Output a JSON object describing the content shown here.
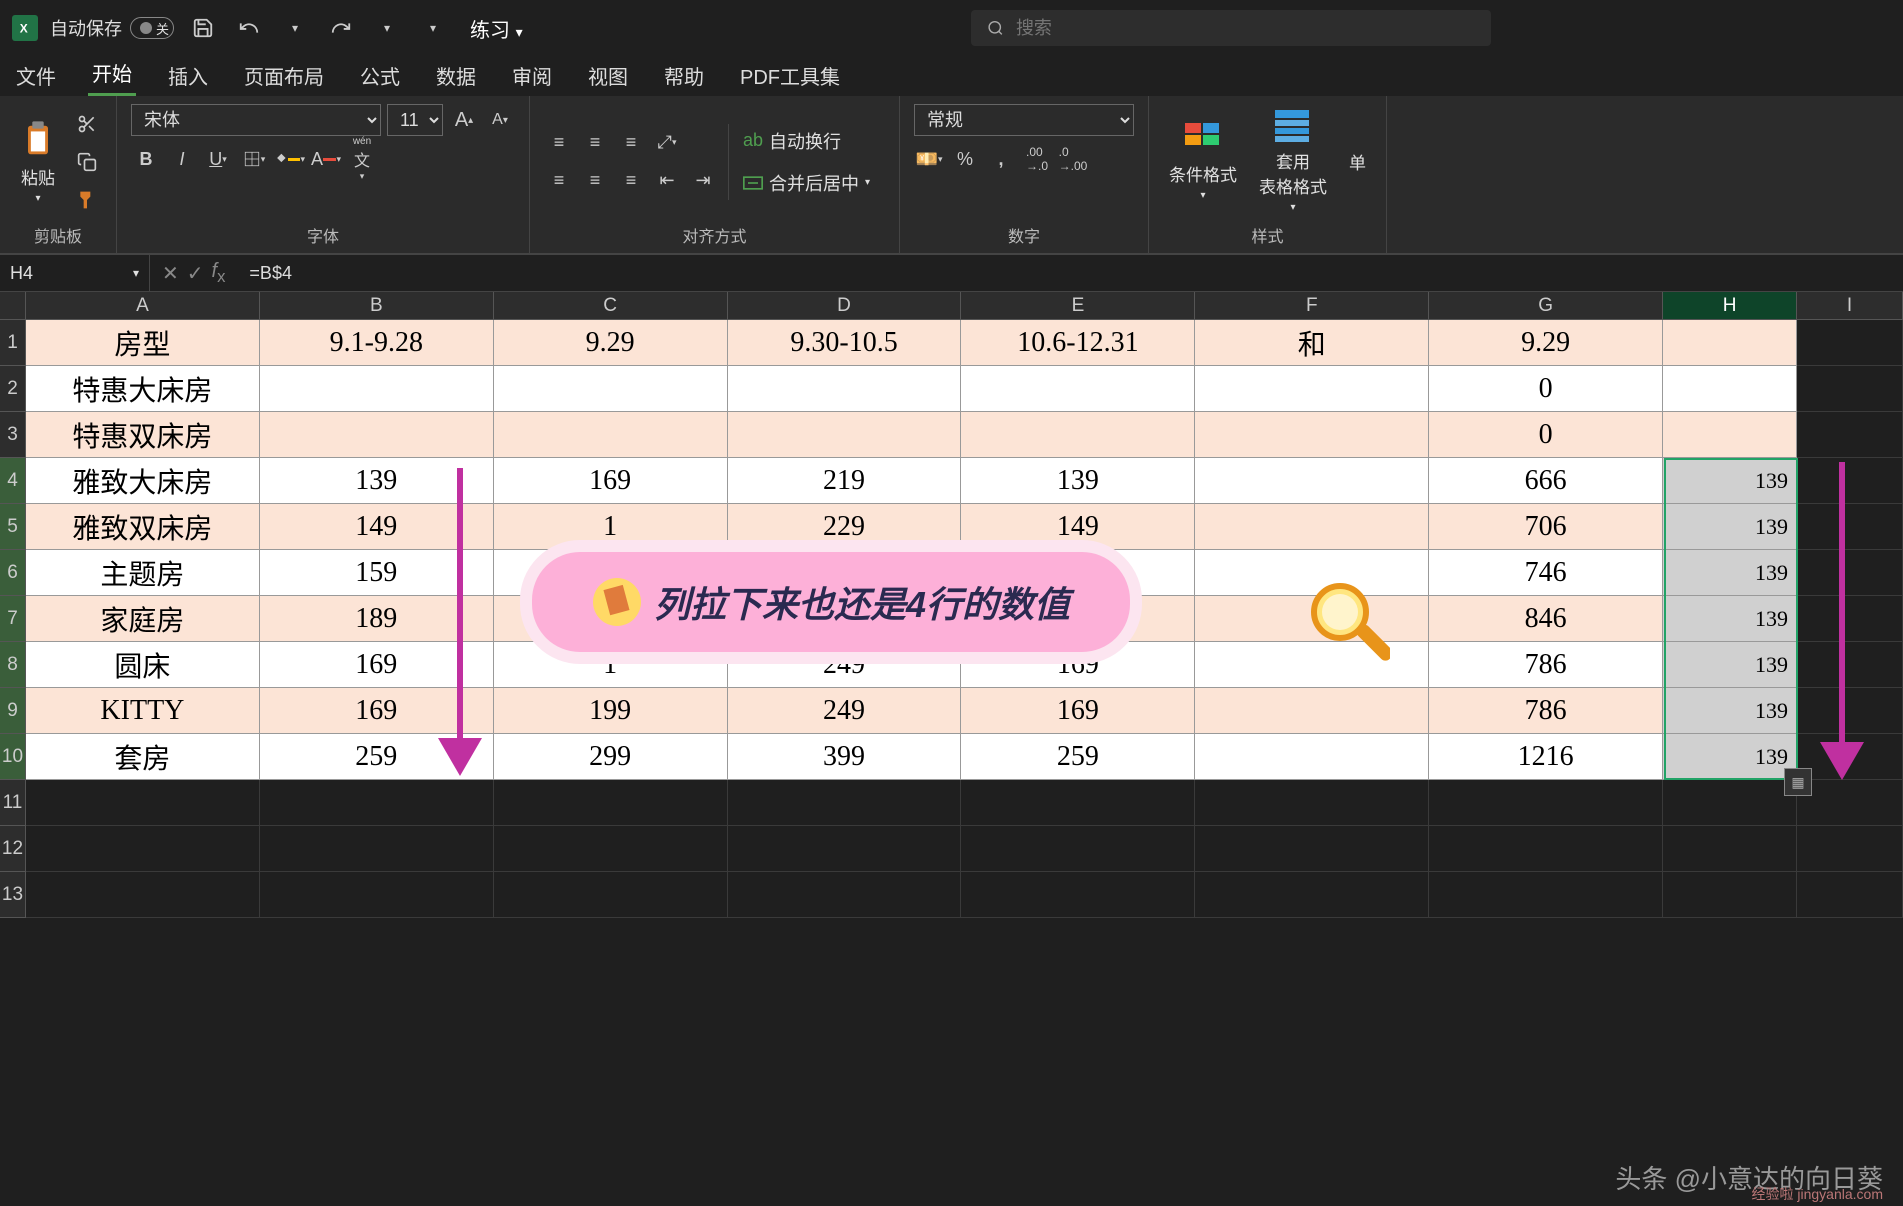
{
  "title_bar": {
    "autosave_label": "自动保存",
    "autosave_state": "关",
    "doc_name": "练习"
  },
  "search": {
    "placeholder": "搜索"
  },
  "tabs": {
    "file": "文件",
    "home": "开始",
    "insert": "插入",
    "layout": "页面布局",
    "formulas": "公式",
    "data": "数据",
    "review": "审阅",
    "view": "视图",
    "help": "帮助",
    "pdf": "PDF工具集"
  },
  "ribbon": {
    "clipboard": {
      "paste": "粘贴",
      "label": "剪贴板"
    },
    "font": {
      "name": "宋体",
      "size": "11",
      "label": "字体",
      "phonetic": "wén"
    },
    "alignment": {
      "wrap": "自动换行",
      "merge": "合并后居中",
      "label": "对齐方式"
    },
    "number": {
      "format": "常规",
      "label": "数字"
    },
    "styles": {
      "cond": "条件格式",
      "table": "套用\n表格格式",
      "cell": "单",
      "label": "样式"
    }
  },
  "name_box": "H4",
  "formula": "=B$4",
  "columns": [
    "A",
    "B",
    "C",
    "D",
    "E",
    "F",
    "G",
    "H",
    "I"
  ],
  "rows": [
    {
      "n": "1",
      "o": true,
      "A": "房型",
      "B": "9.1-9.28",
      "C": "9.29",
      "D": "9.30-10.5",
      "E": "10.6-12.31",
      "F": "和",
      "G": "9.29",
      "H": ""
    },
    {
      "n": "2",
      "o": false,
      "A": "特惠大床房",
      "B": "",
      "C": "",
      "D": "",
      "E": "",
      "F": "",
      "G": "0",
      "H": ""
    },
    {
      "n": "3",
      "o": true,
      "A": "特惠双床房",
      "B": "",
      "C": "",
      "D": "",
      "E": "",
      "F": "",
      "G": "0",
      "H": ""
    },
    {
      "n": "4",
      "o": false,
      "A": "雅致大床房",
      "B": "139",
      "C": "169",
      "D": "219",
      "E": "139",
      "F": "",
      "G": "666",
      "H": "139"
    },
    {
      "n": "5",
      "o": true,
      "A": "雅致双床房",
      "B": "149",
      "C": "1",
      "D": "229",
      "E": "149",
      "F": "",
      "G": "706",
      "H": "139"
    },
    {
      "n": "6",
      "o": false,
      "A": "主题房",
      "B": "159",
      "C": "",
      "D": "",
      "E": "",
      "F": "",
      "G": "746",
      "H": "139"
    },
    {
      "n": "7",
      "o": true,
      "A": "家庭房",
      "B": "189",
      "C": "",
      "D": "",
      "E": "",
      "F": "",
      "G": "846",
      "H": "139"
    },
    {
      "n": "8",
      "o": false,
      "A": "圆床",
      "B": "169",
      "C": "1",
      "D": "249",
      "E": "169",
      "F": "",
      "G": "786",
      "H": "139"
    },
    {
      "n": "9",
      "o": true,
      "A": "KITTY",
      "B": "169",
      "C": "199",
      "D": "249",
      "E": "169",
      "F": "",
      "G": "786",
      "H": "139"
    },
    {
      "n": "10",
      "o": false,
      "A": "套房",
      "B": "259",
      "C": "299",
      "D": "399",
      "E": "259",
      "F": "",
      "G": "1216",
      "H": "139"
    },
    {
      "n": "11",
      "o": false,
      "A": "",
      "B": "",
      "C": "",
      "D": "",
      "E": "",
      "F": "",
      "G": "",
      "H": ""
    },
    {
      "n": "12",
      "o": false,
      "A": "",
      "B": "",
      "C": "",
      "D": "",
      "E": "",
      "F": "",
      "G": "",
      "H": ""
    },
    {
      "n": "13",
      "o": false,
      "A": "",
      "B": "",
      "C": "",
      "D": "",
      "E": "",
      "F": "",
      "G": "",
      "H": ""
    }
  ],
  "annotation": {
    "speech_text": "列拉下来也还是4行的数值",
    "watermark": "头条 @小意达的向日葵",
    "watermark2": "经验啦 jingyanla.com"
  }
}
